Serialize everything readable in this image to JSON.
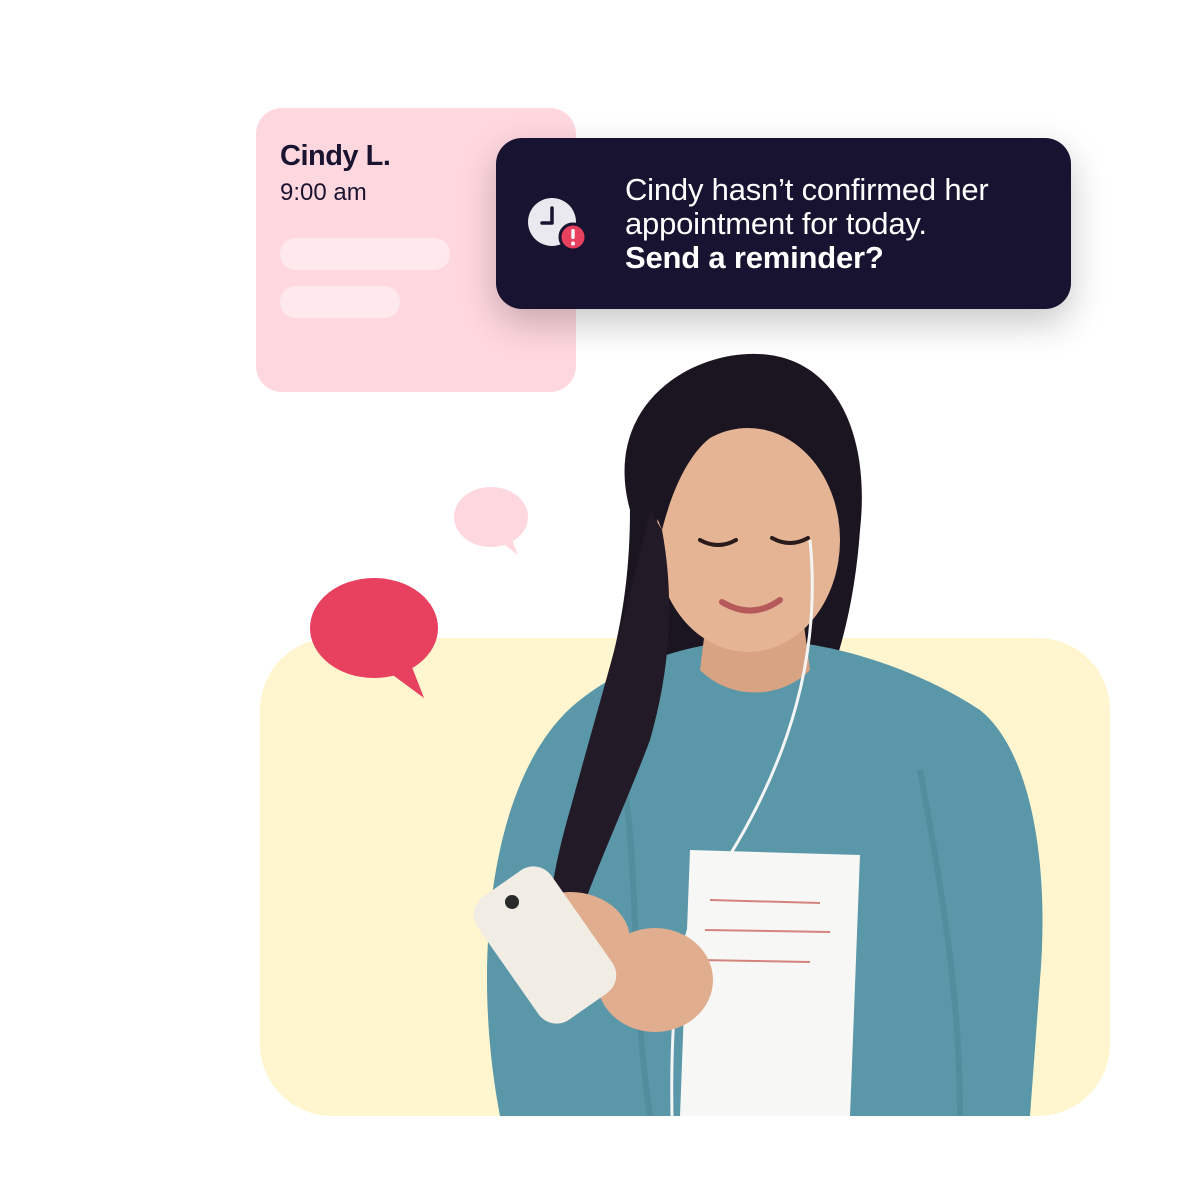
{
  "appointment_card": {
    "name": "Cindy L.",
    "time": "9:00 am"
  },
  "notification": {
    "line1": "Cindy hasn’t confirmed her",
    "line2": "appointment for today.",
    "cta": "Send a reminder?",
    "icon": "clock-alert-icon"
  },
  "colors": {
    "card_pink": "#ffd7df",
    "notification_bg": "#181330",
    "alert_red": "#e8405f",
    "backdrop_yellow": "#fff6cf",
    "sweater_blue": "#5a97a8",
    "hair": "#1a1520"
  },
  "illustration": {
    "subject": "woman-with-phone-photo"
  }
}
